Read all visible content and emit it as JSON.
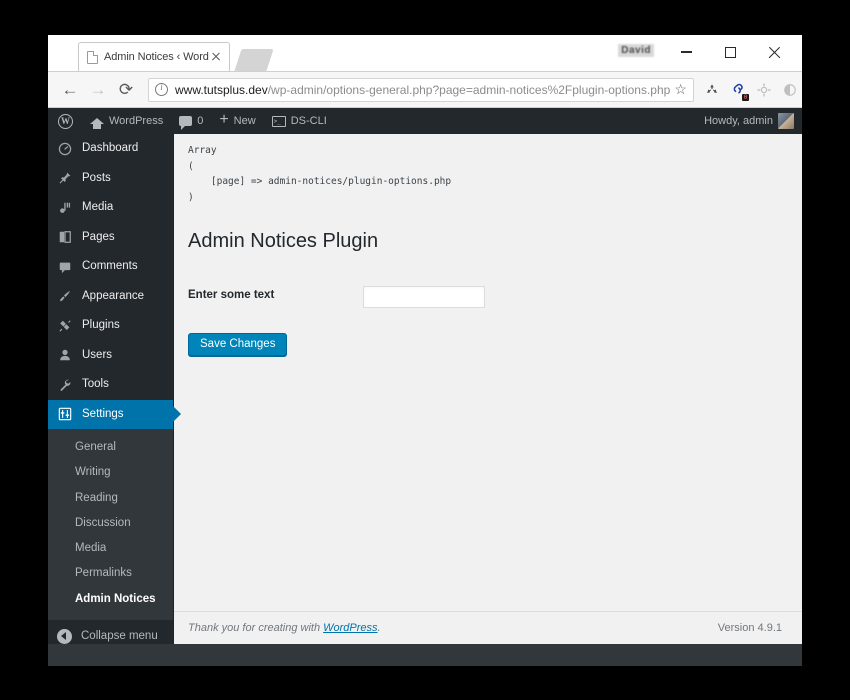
{
  "browser": {
    "tab": {
      "title": "Admin Notices ‹ WordPr",
      "favicon": "page-icon",
      "close": "×"
    },
    "window_user_label": "David",
    "controls": {
      "minimize": "minimize-icon",
      "maximize": "maximize-icon",
      "close": "close-icon"
    },
    "nav": {
      "back": "←",
      "forward": "→",
      "reload": "⟳"
    },
    "omnibox": {
      "security_icon": "info-icon",
      "host": "www.tutsplus.dev",
      "path": "/wp-admin/options-general.php?page=admin-notices%2Fplugin-options.php",
      "bookmark_star": "☆"
    },
    "extensions": [
      {
        "name": "recycle-icon",
        "glyph": "♻",
        "faded": false,
        "badge": null
      },
      {
        "name": "link-icon",
        "glyph": "🔗",
        "faded": false,
        "badge": "0"
      },
      {
        "name": "gear-icon",
        "glyph": "⚙",
        "faded": true,
        "badge": null
      },
      {
        "name": "moon-icon",
        "glyph": "◐",
        "faded": true,
        "badge": null
      }
    ],
    "menu_icon": "kebab-menu-icon"
  },
  "adminbar": {
    "logo": "W",
    "site_name": "WordPress",
    "comments_count": "0",
    "new_label": "New",
    "cli_label": "DS-CLI",
    "cli_glyph": ">_",
    "howdy": "Howdy, admin"
  },
  "sidebar": {
    "items": [
      {
        "label": "Dashboard",
        "icon": "dashboard-icon",
        "glyph": "◷"
      },
      {
        "separator": true
      },
      {
        "label": "Posts",
        "icon": "pin-icon",
        "glyph": "✎"
      },
      {
        "label": "Media",
        "icon": "media-icon",
        "glyph": "♫"
      },
      {
        "label": "Pages",
        "icon": "pages-icon",
        "glyph": "❐"
      },
      {
        "label": "Comments",
        "icon": "comments-icon",
        "glyph": "▰"
      },
      {
        "separator": true
      },
      {
        "label": "Appearance",
        "icon": "brush-icon",
        "glyph": "✒"
      },
      {
        "label": "Plugins",
        "icon": "plug-icon",
        "glyph": "⚊"
      },
      {
        "label": "Users",
        "icon": "user-icon",
        "glyph": "👤"
      },
      {
        "label": "Tools",
        "icon": "wrench-icon",
        "glyph": "🔧"
      },
      {
        "label": "Settings",
        "icon": "settings-icon",
        "glyph": "⚙",
        "active": true
      }
    ],
    "submenu": [
      {
        "label": "General"
      },
      {
        "label": "Writing"
      },
      {
        "label": "Reading"
      },
      {
        "label": "Discussion"
      },
      {
        "label": "Media"
      },
      {
        "label": "Permalinks"
      },
      {
        "label": "Admin Notices",
        "current": true
      }
    ],
    "collapse_label": "Collapse menu",
    "active_color": "#0073aa",
    "background_color": "#23282d",
    "submenu_background_color": "#32373c"
  },
  "content": {
    "var_dump": "Array\n(\n    [page] => admin-notices/plugin-options.php\n)",
    "page_title": "Admin Notices Plugin",
    "form": {
      "field_label": "Enter some text",
      "field_value": "",
      "field_placeholder": "",
      "submit_label": "Save Changes"
    }
  },
  "footer": {
    "thanks_prefix": "Thank you for creating with ",
    "thanks_link": "WordPress",
    "thanks_suffix": ".",
    "version": "Version 4.9.1"
  }
}
